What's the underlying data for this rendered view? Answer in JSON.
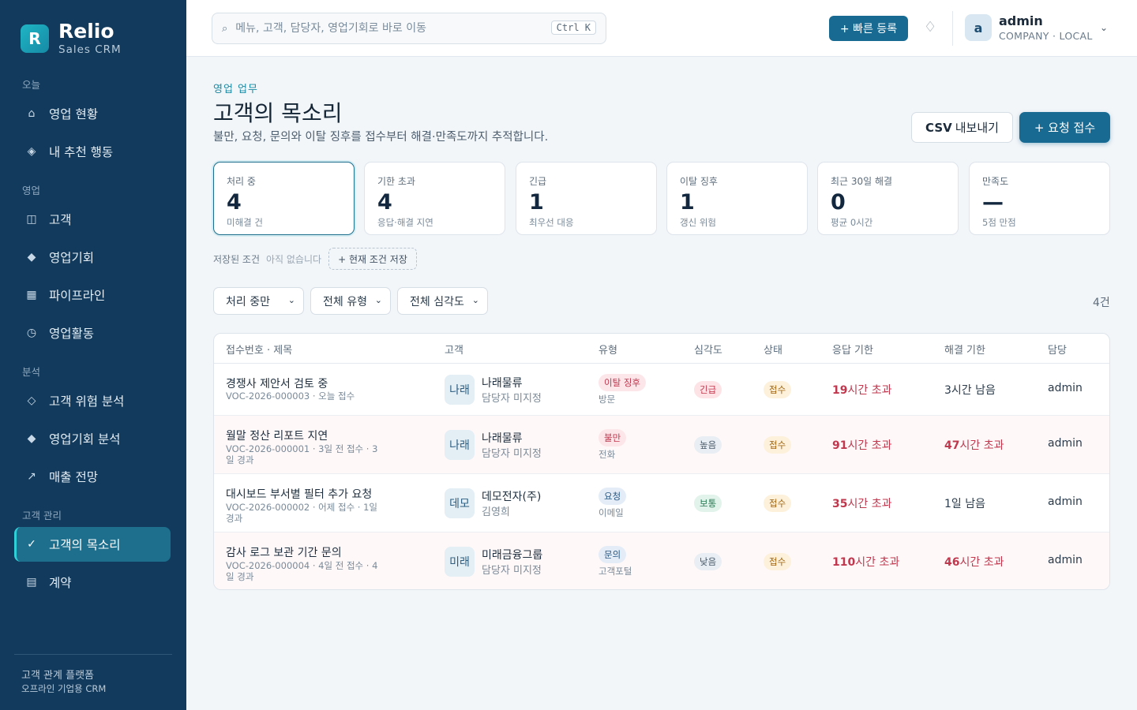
{
  "brand": {
    "logo_letter": "R",
    "name": "Relio",
    "subtitle": "Sales CRM"
  },
  "sidebar": {
    "sections": [
      {
        "label": "오늘"
      },
      {
        "label": "영업"
      },
      {
        "label": "분석"
      },
      {
        "label": "고객 관리"
      }
    ],
    "items": [
      {
        "label": "영업 현황",
        "icon": "home-icon"
      },
      {
        "label": "내 추천 행동",
        "icon": "diamond-icon"
      },
      {
        "label": "고객",
        "icon": "columns-icon"
      },
      {
        "label": "영업기회",
        "icon": "diamond-filled-icon"
      },
      {
        "label": "파이프라인",
        "icon": "grid-icon"
      },
      {
        "label": "영업활동",
        "icon": "clock-icon"
      },
      {
        "label": "고객 위험 분석",
        "icon": "diamond-outline-icon"
      },
      {
        "label": "영업기회 분석",
        "icon": "diamond-filled-icon"
      },
      {
        "label": "매출 전망",
        "icon": "trend-arrow-icon"
      },
      {
        "label": "고객의 목소리",
        "icon": "check-icon",
        "active": true
      },
      {
        "label": "계약",
        "icon": "document-icon"
      }
    ],
    "footer": {
      "line1": "고객 관계 플랫폼",
      "line2": "오프라인 기업용 CRM"
    }
  },
  "topbar": {
    "search_placeholder": "메뉴, 고객, 담당자, 영업기회로 바로 이동",
    "shortcut": "Ctrl K",
    "quick_add": "+ 빠른 등록",
    "user": {
      "initial": "a",
      "name": "admin",
      "role": "COMPANY · LOCAL"
    }
  },
  "page": {
    "eyebrow": "영업 업무",
    "title": "고객의 목소리",
    "description": "불만, 요청, 문의와 이탈 징후를 접수부터 해결·만족도까지 추적합니다.",
    "csv_bold": "CSV",
    "csv_rest": "내보내기",
    "new_request": "+ 요청 접수"
  },
  "kpis": [
    {
      "label": "처리 중",
      "value": "4",
      "sub": "미해결 건",
      "active": true
    },
    {
      "label": "기한 초과",
      "value": "4",
      "sub": "응답·해결 지연"
    },
    {
      "label": "긴급",
      "value": "1",
      "sub": "최우선 대응"
    },
    {
      "label": "이탈 징후",
      "value": "1",
      "sub": "갱신 위험"
    },
    {
      "label": "최근 30일 해결",
      "value": "0",
      "sub": "평균 0시간"
    },
    {
      "label": "만족도",
      "value": "—",
      "sub": "5점 만점"
    }
  ],
  "saved": {
    "label": "저장된 조건",
    "empty": "아직 없습니다",
    "save_button": "+ 현재 조건 저장"
  },
  "filters": [
    {
      "value": "처리 중만"
    },
    {
      "value": "전체 유형"
    },
    {
      "value": "전체 심각도"
    }
  ],
  "result_count": "4건",
  "table": {
    "headers": [
      "접수번호 · 제목",
      "고객",
      "유형",
      "심각도",
      "상태",
      "응답 기한",
      "해결 기한",
      "담당"
    ],
    "rows": [
      {
        "title": "경쟁사 제안서 검토 중",
        "meta": "VOC-2026-000003 · 오늘 접수",
        "badge": "나래",
        "customer": "나래물류",
        "owner": "담당자 미지정",
        "type": "이탈 징후",
        "channel": "방문",
        "severity": "긴급",
        "status": "접수",
        "response_num": "19",
        "response_unit": "시간 초과",
        "resolve_num": "3",
        "resolve_unit": "시간 남음",
        "assignee": "admin"
      },
      {
        "title": "월말 정산 리포트 지연",
        "meta": "VOC-2026-000001 · 3일 전 접수 · 3일 경과",
        "badge": "나래",
        "customer": "나래물류",
        "owner": "담당자 미지정",
        "type": "불만",
        "channel": "전화",
        "severity": "높음",
        "status": "접수",
        "response_num": "91",
        "response_unit": "시간 초과",
        "resolve_num": "47",
        "resolve_unit": "시간 초과",
        "assignee": "admin"
      },
      {
        "title": "대시보드 부서별 필터 추가 요청",
        "meta": "VOC-2026-000002 · 어제 접수 · 1일 경과",
        "badge": "데모",
        "customer": "데모전자(주)",
        "owner": "김영희",
        "type": "요청",
        "channel": "이메일",
        "severity": "보통",
        "status": "접수",
        "response_num": "35",
        "response_unit": "시간 초과",
        "resolve_num": "1",
        "resolve_unit": "일 남음",
        "assignee": "admin"
      },
      {
        "title": "감사 로그 보관 기간 문의",
        "meta": "VOC-2026-000004 · 4일 전 접수 · 4일 경과",
        "badge": "미래",
        "customer": "미래금융그룹",
        "owner": "담당자 미지정",
        "type": "문의",
        "channel": "고객포털",
        "severity": "낮음",
        "status": "접수",
        "response_num": "110",
        "response_unit": "시간 초과",
        "resolve_num": "46",
        "resolve_unit": "시간 초과",
        "assignee": "admin"
      }
    ]
  }
}
